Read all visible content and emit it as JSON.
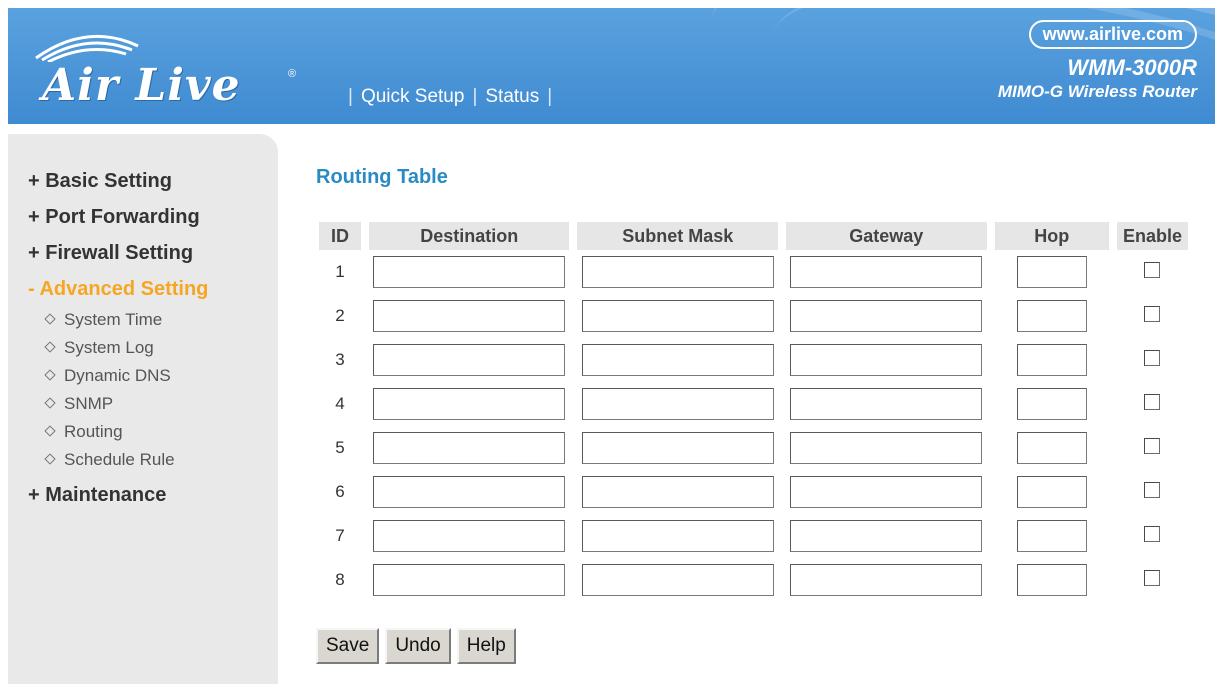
{
  "header": {
    "logo_text": "Air Live",
    "logo_registered": "®",
    "nav": [
      "Quick Setup",
      "Status"
    ],
    "url": "www.airlive.com",
    "model": "WMM-3000R",
    "model_subtitle": "MIMO-G Wireless Router"
  },
  "sidebar": {
    "items": [
      {
        "label": "+ Basic Setting",
        "active": false
      },
      {
        "label": "+ Port Forwarding",
        "active": false
      },
      {
        "label": "+ Firewall Setting",
        "active": false
      },
      {
        "label": "- Advanced Setting",
        "active": true
      },
      {
        "label": "+ Maintenance",
        "active": false
      }
    ],
    "sub_items": [
      "System Time",
      "System Log",
      "Dynamic DNS",
      "SNMP",
      "Routing",
      "Schedule Rule"
    ]
  },
  "main": {
    "title": "Routing Table",
    "columns": [
      "ID",
      "Destination",
      "Subnet Mask",
      "Gateway",
      "Hop",
      "Enable"
    ],
    "rows": [
      {
        "id": "1",
        "destination": "",
        "subnet_mask": "",
        "gateway": "",
        "hop": "",
        "enable": false
      },
      {
        "id": "2",
        "destination": "",
        "subnet_mask": "",
        "gateway": "",
        "hop": "",
        "enable": false
      },
      {
        "id": "3",
        "destination": "",
        "subnet_mask": "",
        "gateway": "",
        "hop": "",
        "enable": false
      },
      {
        "id": "4",
        "destination": "",
        "subnet_mask": "",
        "gateway": "",
        "hop": "",
        "enable": false
      },
      {
        "id": "5",
        "destination": "",
        "subnet_mask": "",
        "gateway": "",
        "hop": "",
        "enable": false
      },
      {
        "id": "6",
        "destination": "",
        "subnet_mask": "",
        "gateway": "",
        "hop": "",
        "enable": false
      },
      {
        "id": "7",
        "destination": "",
        "subnet_mask": "",
        "gateway": "",
        "hop": "",
        "enable": false
      },
      {
        "id": "8",
        "destination": "",
        "subnet_mask": "",
        "gateway": "",
        "hop": "",
        "enable": false
      }
    ],
    "buttons": {
      "save": "Save",
      "undo": "Undo",
      "help": "Help"
    }
  },
  "colors": {
    "header_blue": "#4a93d6",
    "title_blue": "#2a8bc4",
    "active_orange": "#f5a623",
    "sidebar_gray": "#e9e9e9"
  }
}
